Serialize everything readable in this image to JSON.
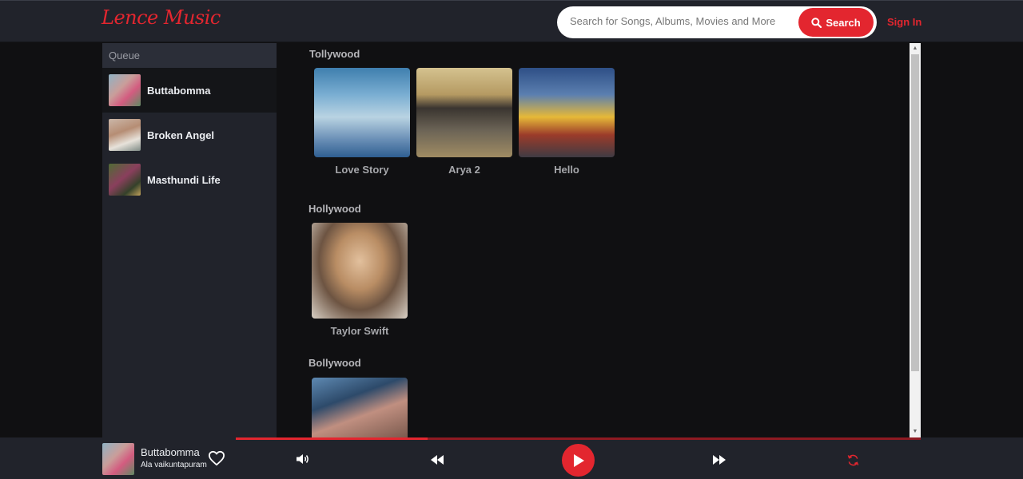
{
  "header": {
    "logo": "Lence Music",
    "search_placeholder": "Search for Songs, Albums, Movies and More",
    "search_button": "Search",
    "sign_in": "Sign In"
  },
  "sidebar": {
    "title": "Queue",
    "items": [
      {
        "label": "Buttabomma"
      },
      {
        "label": "Broken Angel"
      },
      {
        "label": "Masthundi Life"
      }
    ]
  },
  "sections": [
    {
      "title": "Tollywood",
      "cards": [
        {
          "name": "Love Story"
        },
        {
          "name": "Arya 2"
        },
        {
          "name": "Hello"
        }
      ]
    },
    {
      "title": "Hollywood",
      "cards": [
        {
          "name": "Taylor Swift"
        }
      ]
    },
    {
      "title": "Bollywood",
      "cards": [
        {
          "name": ""
        }
      ]
    }
  ],
  "player": {
    "title": "Buttabomma",
    "subtitle": "Ala vaikuntapuram",
    "progress": 0.28
  },
  "colors": {
    "accent": "#e3262f",
    "header_bg": "#21232b",
    "page_bg": "#101012"
  },
  "icons": {
    "search": "search-icon",
    "heart": "heart-icon",
    "volume": "volume-icon",
    "previous": "previous-icon",
    "play": "play-icon",
    "next": "next-icon",
    "repeat": "repeat-icon"
  }
}
